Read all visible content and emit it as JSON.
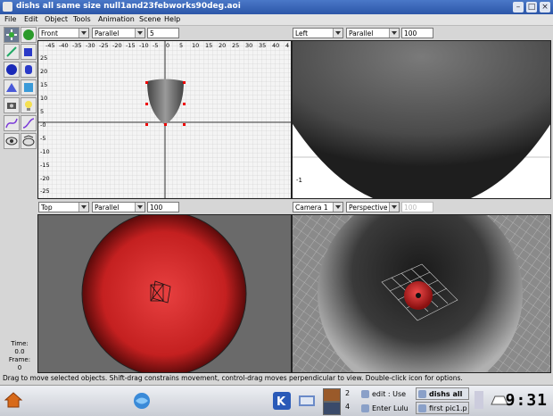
{
  "window": {
    "title": "dishs all same size null1and23febworks90deg.aoi"
  },
  "menu": [
    "File",
    "Edit",
    "Object",
    "Tools",
    "Animation",
    "Scene",
    "Help"
  ],
  "viewports": {
    "tl": {
      "view": "Front",
      "projection": "Parallel",
      "scale": "5",
      "xticks": [
        "-45",
        "-40",
        "-35",
        "-30",
        "-25",
        "-20",
        "-15",
        "-10",
        "-5",
        "0",
        "5",
        "10",
        "15",
        "20",
        "25",
        "30",
        "35",
        "40",
        "4"
      ],
      "yticks": [
        "25",
        "20",
        "15",
        "10",
        "5",
        "-0",
        "-5",
        "-10",
        "-15",
        "-20",
        "-25"
      ]
    },
    "tr": {
      "view": "Left",
      "projection": "Parallel",
      "scale": "100",
      "axis_label": "-1"
    },
    "bl": {
      "view": "Top",
      "projection": "Parallel",
      "scale": "100"
    },
    "br": {
      "view": "Camera 1",
      "projection": "Perspective",
      "scale": "100"
    }
  },
  "time": {
    "time_label": "Time:",
    "time_value": "0.0",
    "frame_label": "Frame:",
    "frame_value": "0"
  },
  "status": "Drag to move selected objects.  Shift-drag constrains movement, control-drag moves perpendicular to view.  Double-click icon for options.",
  "taskbar": {
    "desktops": [
      "2",
      "4"
    ],
    "tasks": [
      "edit : Use",
      "dishs all",
      "Enter Lulu",
      "first pic1.p"
    ],
    "clock": "9:31"
  },
  "colors": {
    "title_bar": "#2c56a8",
    "object_red": "#d42a2a",
    "viewport_gray": "#6a6a6a"
  }
}
